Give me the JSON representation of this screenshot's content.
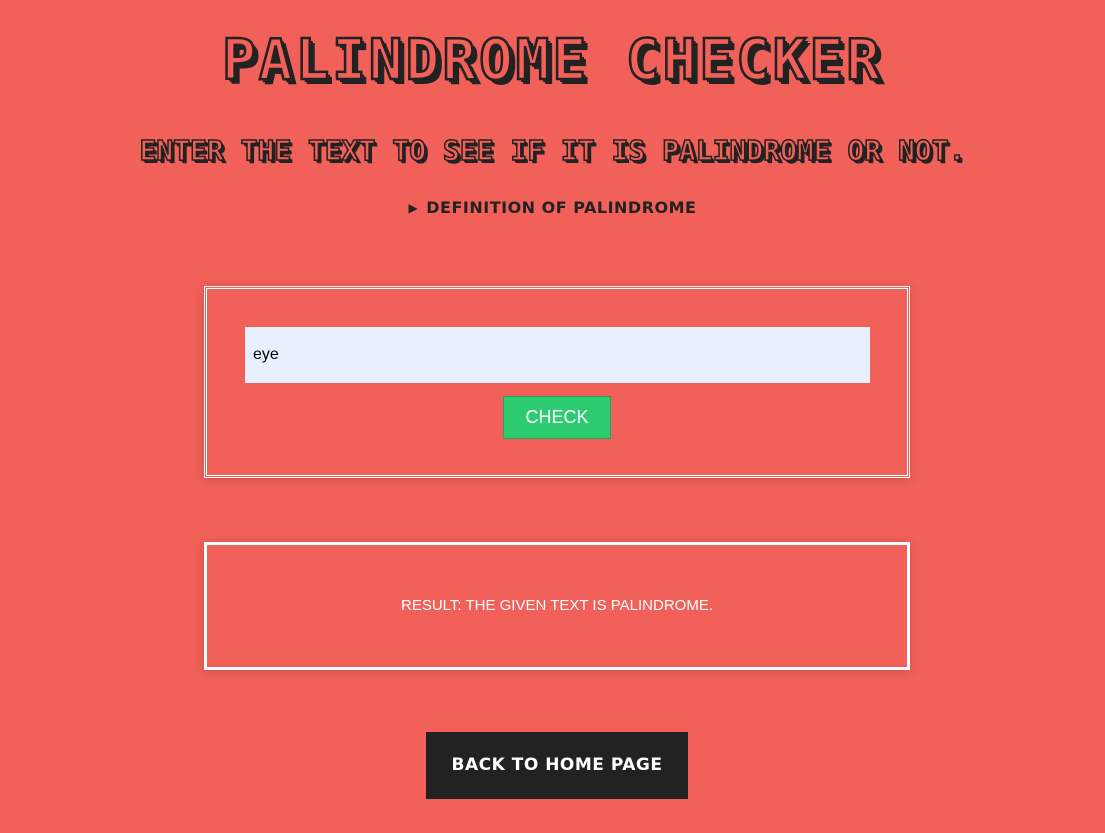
{
  "header": {
    "title": "PALINDROME CHECKER",
    "subtitle": "ENTER THE TEXT TO SEE IF IT IS PALINDROME OR NOT."
  },
  "definition": {
    "label": "DEFINITION OF PALINDROME",
    "expanded": false,
    "icon": "triangle-right-icon"
  },
  "form": {
    "input_value": "eye",
    "check_label": "CHECK"
  },
  "result": {
    "text": "RESULT: THE GIVEN TEXT IS PALINDROME."
  },
  "footer": {
    "home_label": "BACK TO HOME PAGE"
  },
  "colors": {
    "background": "#f16059",
    "dark": "#222222",
    "check_button": "#2ecc71",
    "input_bg": "#e8f0fe"
  }
}
